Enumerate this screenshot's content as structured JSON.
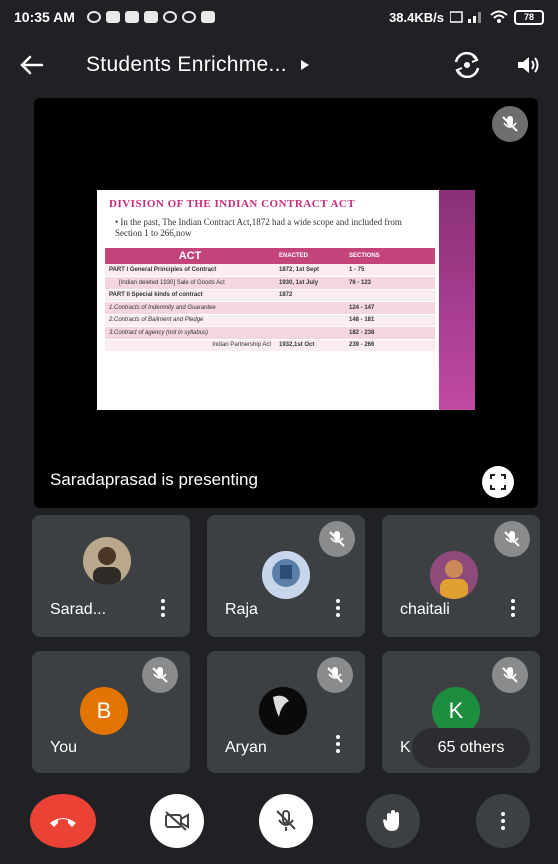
{
  "status_bar": {
    "time": "10:35 AM",
    "net_speed": "38.4KB/s",
    "battery": "78"
  },
  "header": {
    "title": "Students Enrichme..."
  },
  "presentation": {
    "presenter_text": "Saradaprasad is presenting",
    "slide": {
      "title": "DIVISION OF THE INDIAN CONTRACT ACT",
      "text": "• In the past, The Indian Contract Act,1872 had a wide scope and included from Section 1 to 266,now",
      "headers": [
        "ACT",
        "ENACTED",
        "SECTIONS"
      ],
      "rows": [
        [
          "PART I General Principles of Contract",
          "1872, 1st Sept",
          "1 - 75"
        ],
        [
          "[Indian deleted 1930] Sale of Goods Act",
          "1930, 1st July",
          "76 - 123"
        ],
        [
          "PART II Special kinds of contract",
          "1872",
          ""
        ],
        [
          "1.Contracts of Indemnity and Guarantee",
          "",
          "124 - 147"
        ],
        [
          "2.Contracts of Bailment and Pledge",
          "",
          "148 - 181"
        ],
        [
          "3.Contract of agency (not in syllabus)",
          "",
          "182 - 238"
        ],
        [
          "Indian Partnership Act",
          "1932,1st Oct",
          "239 - 266"
        ]
      ]
    }
  },
  "participants": [
    {
      "name": "Sarad...",
      "avatar_type": "photo"
    },
    {
      "name": "Raja",
      "avatar_type": "photo"
    },
    {
      "name": "chaitali",
      "avatar_type": "photo"
    },
    {
      "name": "You",
      "avatar_letter": "B",
      "avatar_color": "#e37400"
    },
    {
      "name": "Aryan",
      "avatar_type": "photo"
    },
    {
      "name": "K",
      "avatar_letter": "K",
      "avatar_color": "#1e8e3e"
    }
  ],
  "others_label": "65 others",
  "colors": {
    "end_call": "#ea4335",
    "tile_bg": "#3c4043",
    "background": "#202124"
  },
  "controls": [
    "end-call",
    "camera-off",
    "mic-off",
    "raise-hand",
    "more-options"
  ]
}
